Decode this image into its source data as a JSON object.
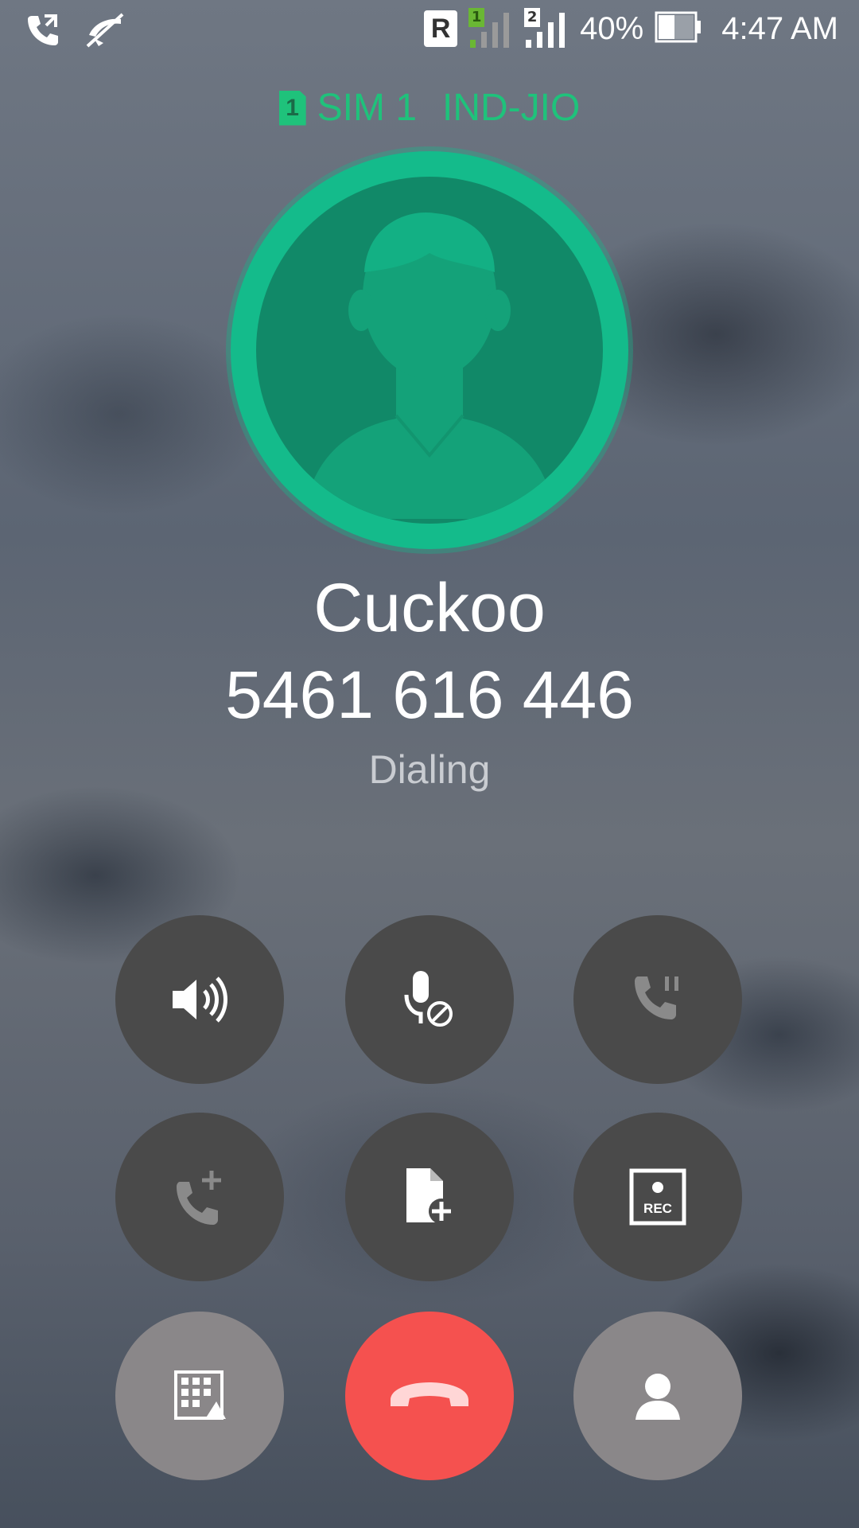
{
  "status_bar": {
    "roaming": "R",
    "sim1_badge": "1",
    "sim2_badge": "2",
    "battery_percent": "40%",
    "time": "4:47 AM",
    "icons": [
      "call-forward-icon",
      "mute-off-icon",
      "roaming-icon",
      "signal-sim1-icon",
      "signal-sim2-icon",
      "battery-icon"
    ]
  },
  "sim": {
    "badge": "1",
    "label": "SIM 1",
    "carrier": "IND-JIO",
    "color": "#1fc27b"
  },
  "contact": {
    "name": "Cuckoo",
    "number": "5461 616 446",
    "status": "Dialing",
    "avatar_color": "#14bb8b"
  },
  "controls": [
    {
      "name": "speaker",
      "icon": "speaker-icon"
    },
    {
      "name": "mute",
      "icon": "mic-off-icon"
    },
    {
      "name": "hold",
      "icon": "hold-call-icon"
    },
    {
      "name": "add-call",
      "icon": "add-call-icon"
    },
    {
      "name": "add-note",
      "icon": "note-add-icon"
    },
    {
      "name": "record",
      "icon": "record-icon",
      "label": "REC"
    },
    {
      "name": "dialpad",
      "icon": "dialpad-icon"
    },
    {
      "name": "end-call",
      "icon": "end-call-icon",
      "color": "#f5514f"
    },
    {
      "name": "contacts",
      "icon": "contact-icon"
    }
  ]
}
